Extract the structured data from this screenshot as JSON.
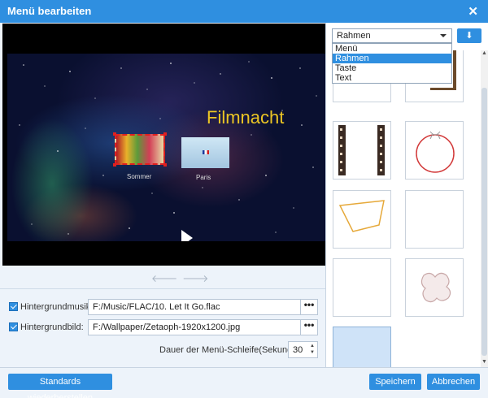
{
  "window": {
    "title": "Menü bearbeiten"
  },
  "preview": {
    "title": "Filmnacht",
    "thumbnails": [
      {
        "label": "Sommer"
      },
      {
        "label": "Paris"
      }
    ]
  },
  "settings": {
    "bg_music": {
      "label": "Hintergrundmusik:",
      "value": "F:/Music/FLAC/10. Let It Go.flac",
      "checked": true
    },
    "bg_image": {
      "label": "Hintergrundbild:",
      "value": "F:/Wallpaper/Zetaoph-1920x1200.jpg",
      "checked": true
    },
    "loop": {
      "label": "Dauer der Menü-Schleife(Sekunde):",
      "value": "30"
    },
    "browse_label": "•••"
  },
  "template_panel": {
    "selected": "Rahmen",
    "options": [
      "Menü",
      "Rahmen",
      "Taste",
      "Text"
    ],
    "highlighted_option": "Rahmen"
  },
  "buttons": {
    "restore": "Standards wiederherstellen",
    "save": "Speichern",
    "cancel": "Abbrechen"
  },
  "colors": {
    "accent": "#2f8fe0",
    "title_gold": "#ecc624"
  }
}
